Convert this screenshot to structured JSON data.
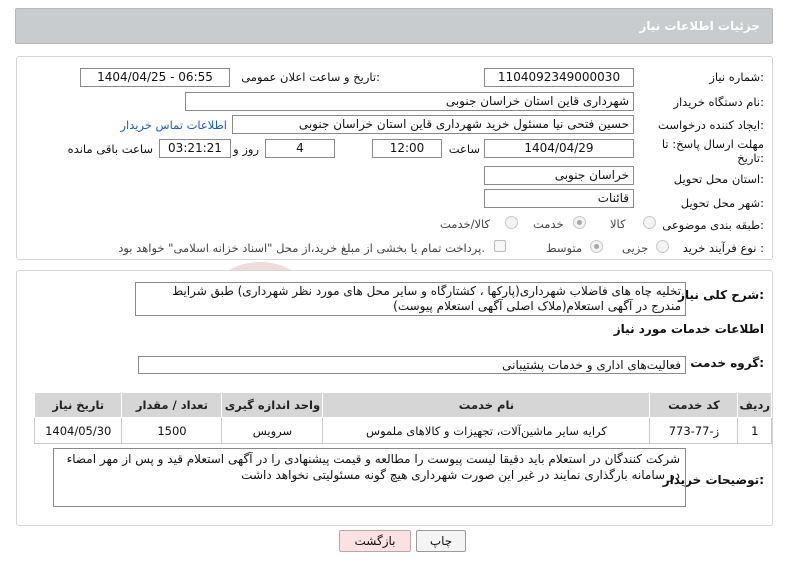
{
  "header": {
    "title": "جزئیات اطلاعات نیاز"
  },
  "fields": {
    "need_number_label": "شماره نیاز:",
    "need_number": "1104092349000030",
    "announce_label": "تاریخ و ساعت اعلان عمومی:",
    "announce_value": "1404/04/25 - 06:55",
    "buyer_org_label": "نام دستگاه خریدار:",
    "buyer_org": "شهرداری قاین استان خراسان جنوبی",
    "creator_label": "ایجاد کننده درخواست:",
    "creator": "حسین فتحی نیا مسئول خرید شهرداری قاین استان خراسان جنوبی",
    "contact_link": "اطلاعات تماس خریدار",
    "deadline_label": "مهلت ارسال پاسخ: تا تاریخ:",
    "deadline_date": "1404/04/29",
    "hour_label": "ساعت",
    "deadline_hour": "12:00",
    "days_value": "4",
    "days_label": "روز و",
    "remaining_time": "03:21:21",
    "remaining_label": "ساعت باقی مانده",
    "province_label": "استان محل تحویل:",
    "province": "خراسان جنوبی",
    "city_label": "شهر محل تحویل:",
    "city": "قائنات",
    "category_label": "طبقه بندی موضوعی:",
    "category_options": [
      "کالا",
      "خدمت",
      "کالا/خدمت"
    ],
    "category_selected": "خدمت",
    "process_label": "نوع فرآیند خرید :",
    "process_options": [
      "جزیی",
      "متوسط"
    ],
    "process_selected": "متوسط",
    "payment_note": "پرداخت تمام یا بخشی از مبلغ خرید،از محل \"اسناد خزانه اسلامی\" خواهد بود."
  },
  "summary": {
    "label": "شرح کلی نیاز:",
    "text": "تخلیه چاه های فاضلاب شهرداری(پارکها ، کشتارگاه و سایر محل های مورد نظر شهرداری) طبق شرایط مندرج در آگهی استعلام(ملاک اصلی آگهی استعلام پیوست)"
  },
  "services": {
    "section_title": "اطلاعات خدمات مورد نیاز",
    "group_label": "گروه خدمت:",
    "group_value": "فعالیت‌های اداری و خدمات پشتیبانی",
    "columns": [
      "ردیف",
      "کد خدمت",
      "نام خدمت",
      "واحد اندازه گیری",
      "تعداد / مقدار",
      "تاریخ نیاز"
    ],
    "rows": [
      [
        "1",
        "ز-77-773",
        "کرایه سایر ماشین‌آلات، تجهیزات و کالاهای ملموس",
        "سرویس",
        "1500",
        "1404/05/30"
      ]
    ]
  },
  "buyer_notes": {
    "label": "توضیحات خریدار:",
    "text": "شرکت کنندگان در استعلام باید دقیقا لیست پیوست را مطالعه و قیمت پیشنهادی را در آگهی استعلام قید و پس از مهر امضاء در سامانه بارگذاری نمایند در غیر این صورت شهرداری هیچ گونه مسئولیتی نخواهد داشت"
  },
  "buttons": {
    "print": "چاپ",
    "back": "بازگشت"
  },
  "watermark": {
    "text": "AriaTender.neT"
  },
  "colors": {
    "header_bg": "#c8ccce",
    "link": "#1b5fb0",
    "back_button_bg": "#fbe1e1",
    "watermark": "#f1dcdc"
  }
}
